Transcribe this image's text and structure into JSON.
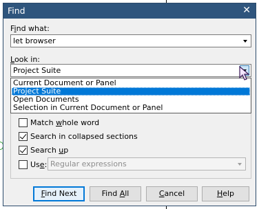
{
  "dialog": {
    "title": "Find"
  },
  "find_what": {
    "label_pre": "F",
    "label_u": "i",
    "label_post": "nd what:",
    "value": "let browser"
  },
  "look_in": {
    "label_u": "L",
    "label_post": "ook in:",
    "value": "Project Suite",
    "options": [
      "Current Document or Panel",
      "Project Suite",
      "Open Documents",
      "Selection in Current Document or Panel"
    ],
    "selected_index": 1
  },
  "options": {
    "match_whole_word": {
      "pre": "Match ",
      "u": "w",
      "post": "hole word",
      "checked": false
    },
    "search_collapsed": {
      "pre": "Search in collapsed sections",
      "u": "",
      "post": "",
      "checked": true
    },
    "search_up": {
      "pre": "Search ",
      "u": "u",
      "post": "p",
      "checked": true
    },
    "use": {
      "pre": "Us",
      "u": "e",
      "post": ":",
      "checked": false,
      "combo_value": "Regular expressions"
    }
  },
  "buttons": {
    "find_next": {
      "u": "F",
      "post": "ind Next"
    },
    "find_all": {
      "pre": "Find ",
      "u": "A",
      "post": "ll"
    },
    "cancel": {
      "u": "C",
      "post": "ancel"
    },
    "help": {
      "u": "H",
      "post": "elp"
    }
  },
  "colors": {
    "titlebar": "#2f557d",
    "selection": "#0078d7"
  }
}
